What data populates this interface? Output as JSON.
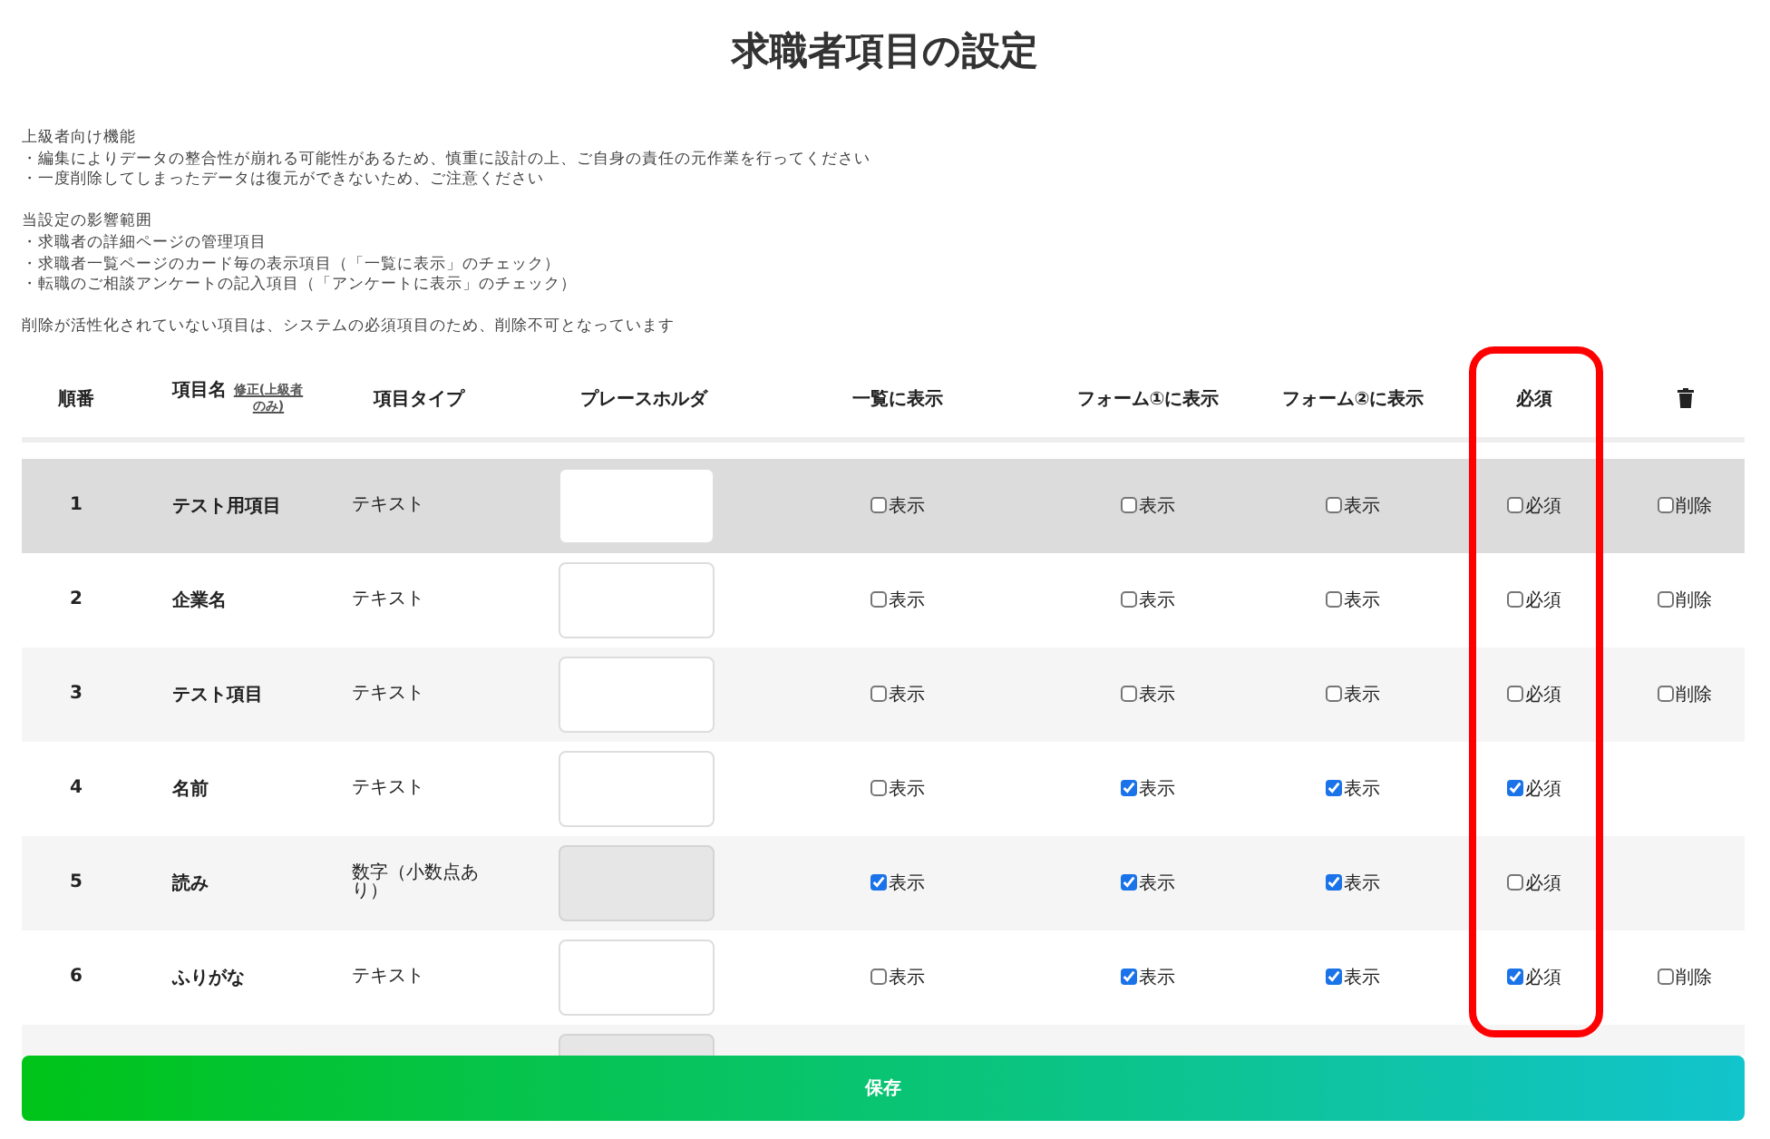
{
  "title": "求職者項目の設定",
  "notes": [
    [
      "上級者向け機能",
      "・編集によりデータの整合性が崩れる可能性があるため、慎重に設計の上、ご自身の責任の元作業を行ってください",
      "・一度削除してしまったデータは復元ができないため、ご注意ください"
    ],
    [
      "当設定の影響範囲",
      "・求職者の詳細ページの管理項目",
      "・求職者一覧ページのカード毎の表示項目（「一覧に表示」のチェック）",
      "・転職のご相談アンケートの記入項目（「アンケートに表示」のチェック）"
    ],
    [
      "削除が活性化されていない項目は、システムの必須項目のため、削除不可となっています"
    ]
  ],
  "columns": {
    "number": "順番",
    "name": "項目名",
    "name_link": "修正(上級者のみ)",
    "type": "項目タイプ",
    "placeholder": "プレースホルダ",
    "list": "一覧に表示",
    "form1": "フォーム①に表示",
    "form2": "フォーム②に表示",
    "required": "必須"
  },
  "rows": [
    {
      "number": "1",
      "name": "テスト用項目",
      "type": "テキスト",
      "highlighted": true,
      "field_disabled": false,
      "list": {
        "label": "表示",
        "checked": false
      },
      "form1": {
        "label": "表示",
        "checked": false
      },
      "form2": {
        "label": "表示",
        "checked": false
      },
      "required": {
        "label": "必須",
        "checked": false
      },
      "delete": {
        "label": "削除",
        "checked": false
      }
    },
    {
      "number": "2",
      "name": "企業名",
      "type": "テキスト",
      "highlighted": false,
      "field_disabled": false,
      "list": {
        "label": "表示",
        "checked": false
      },
      "form1": {
        "label": "表示",
        "checked": false
      },
      "form2": {
        "label": "表示",
        "checked": false
      },
      "required": {
        "label": "必須",
        "checked": false
      },
      "delete": {
        "label": "削除",
        "checked": false
      }
    },
    {
      "number": "3",
      "name": "テスト項目",
      "type": "テキスト",
      "highlighted": false,
      "field_disabled": false,
      "list": {
        "label": "表示",
        "checked": false
      },
      "form1": {
        "label": "表示",
        "checked": false
      },
      "form2": {
        "label": "表示",
        "checked": false
      },
      "required": {
        "label": "必須",
        "checked": false
      },
      "delete": {
        "label": "削除",
        "checked": false
      }
    },
    {
      "number": "4",
      "name": "名前",
      "type": "テキスト",
      "highlighted": false,
      "field_disabled": false,
      "list": {
        "label": "表示",
        "checked": false
      },
      "form1": {
        "label": "表示",
        "checked": true
      },
      "form2": {
        "label": "表示",
        "checked": true
      },
      "required": {
        "label": "必須",
        "checked": true
      }
    },
    {
      "number": "5",
      "name": "読み",
      "type": "数字（小数点あり）",
      "highlighted": false,
      "field_disabled": true,
      "list": {
        "label": "表示",
        "checked": true
      },
      "form1": {
        "label": "表示",
        "checked": true
      },
      "form2": {
        "label": "表示",
        "checked": true
      },
      "required": {
        "label": "必須",
        "checked": false
      }
    },
    {
      "number": "6",
      "name": "ふりがな",
      "type": "テキスト",
      "highlighted": false,
      "field_disabled": false,
      "list": {
        "label": "表示",
        "checked": false
      },
      "form1": {
        "label": "表示",
        "checked": true
      },
      "form2": {
        "label": "表示",
        "checked": true
      },
      "required": {
        "label": "必須",
        "checked": true
      },
      "delete": {
        "label": "削除",
        "checked": false
      }
    },
    {
      "highlighted": false,
      "field_disabled": true
    }
  ],
  "save_button": "保存"
}
